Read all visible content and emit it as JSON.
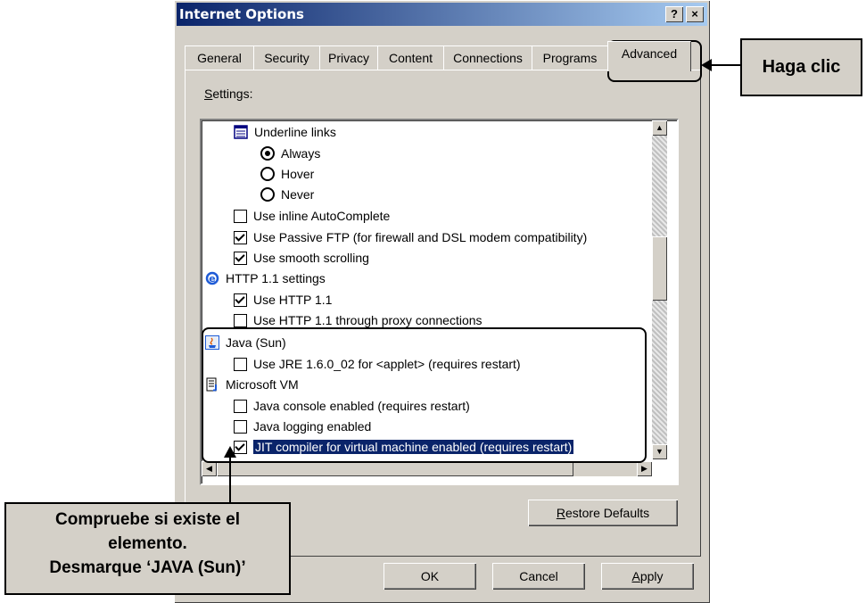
{
  "window": {
    "title": "Internet Options",
    "help_button": "?",
    "close_button": "×"
  },
  "tabs": [
    "General",
    "Security",
    "Privacy",
    "Content",
    "Connections",
    "Programs",
    "Advanced"
  ],
  "active_tab": "Advanced",
  "settings_label": {
    "underlined": "S",
    "rest": "ettings:"
  },
  "settings_list": [
    {
      "type": "group",
      "icon": "list-icon",
      "label": "Underline links"
    },
    {
      "type": "radio",
      "checked": true,
      "label": "Always"
    },
    {
      "type": "radio",
      "checked": false,
      "label": "Hover"
    },
    {
      "type": "radio",
      "checked": false,
      "label": "Never"
    },
    {
      "type": "checkbox",
      "checked": false,
      "label": "Use inline AutoComplete"
    },
    {
      "type": "checkbox",
      "checked": true,
      "label": "Use Passive FTP (for firewall and DSL modem compatibility)"
    },
    {
      "type": "checkbox",
      "checked": true,
      "label": "Use smooth scrolling"
    },
    {
      "type": "group",
      "icon": "ie-icon",
      "label": "HTTP 1.1 settings"
    },
    {
      "type": "checkbox",
      "checked": true,
      "label": "Use HTTP 1.1"
    },
    {
      "type": "checkbox",
      "checked": false,
      "label": "Use HTTP 1.1 through proxy connections"
    },
    {
      "type": "group",
      "icon": "java-icon",
      "label": "Java (Sun)"
    },
    {
      "type": "checkbox",
      "checked": false,
      "label": "Use JRE 1.6.0_02 for <applet> (requires restart)"
    },
    {
      "type": "group",
      "icon": "document-icon",
      "label": "Microsoft VM"
    },
    {
      "type": "checkbox",
      "checked": false,
      "label": "Java console enabled (requires restart)"
    },
    {
      "type": "checkbox",
      "checked": false,
      "label": "Java logging enabled"
    },
    {
      "type": "checkbox",
      "checked": true,
      "selected": true,
      "label": "JIT compiler for virtual machine enabled (requires restart)"
    }
  ],
  "buttons": {
    "restore_defaults": {
      "underlined": "R",
      "rest": "estore Defaults"
    },
    "ok": "OK",
    "cancel": "Cancel",
    "apply": {
      "underlined": "A",
      "rest": "pply"
    }
  },
  "callouts": {
    "click_here": "Haga clic",
    "instruction_line1": "Compruebe si existe el",
    "instruction_line2": "elemento.",
    "instruction_line3": "Desmarque ‘JAVA (Sun)’"
  }
}
